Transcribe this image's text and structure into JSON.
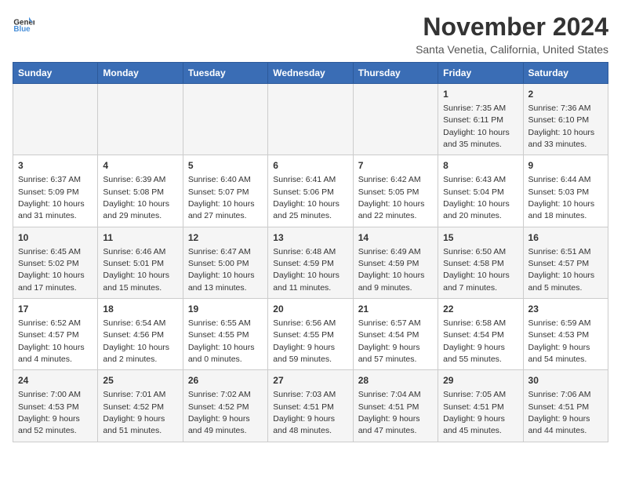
{
  "header": {
    "logo_line1": "General",
    "logo_line2": "Blue",
    "title": "November 2024",
    "location": "Santa Venetia, California, United States"
  },
  "columns": [
    "Sunday",
    "Monday",
    "Tuesday",
    "Wednesday",
    "Thursday",
    "Friday",
    "Saturday"
  ],
  "weeks": [
    [
      {
        "day": "",
        "info": ""
      },
      {
        "day": "",
        "info": ""
      },
      {
        "day": "",
        "info": ""
      },
      {
        "day": "",
        "info": ""
      },
      {
        "day": "",
        "info": ""
      },
      {
        "day": "1",
        "info": "Sunrise: 7:35 AM\nSunset: 6:11 PM\nDaylight: 10 hours\nand 35 minutes."
      },
      {
        "day": "2",
        "info": "Sunrise: 7:36 AM\nSunset: 6:10 PM\nDaylight: 10 hours\nand 33 minutes."
      }
    ],
    [
      {
        "day": "3",
        "info": "Sunrise: 6:37 AM\nSunset: 5:09 PM\nDaylight: 10 hours\nand 31 minutes."
      },
      {
        "day": "4",
        "info": "Sunrise: 6:39 AM\nSunset: 5:08 PM\nDaylight: 10 hours\nand 29 minutes."
      },
      {
        "day": "5",
        "info": "Sunrise: 6:40 AM\nSunset: 5:07 PM\nDaylight: 10 hours\nand 27 minutes."
      },
      {
        "day": "6",
        "info": "Sunrise: 6:41 AM\nSunset: 5:06 PM\nDaylight: 10 hours\nand 25 minutes."
      },
      {
        "day": "7",
        "info": "Sunrise: 6:42 AM\nSunset: 5:05 PM\nDaylight: 10 hours\nand 22 minutes."
      },
      {
        "day": "8",
        "info": "Sunrise: 6:43 AM\nSunset: 5:04 PM\nDaylight: 10 hours\nand 20 minutes."
      },
      {
        "day": "9",
        "info": "Sunrise: 6:44 AM\nSunset: 5:03 PM\nDaylight: 10 hours\nand 18 minutes."
      }
    ],
    [
      {
        "day": "10",
        "info": "Sunrise: 6:45 AM\nSunset: 5:02 PM\nDaylight: 10 hours\nand 17 minutes."
      },
      {
        "day": "11",
        "info": "Sunrise: 6:46 AM\nSunset: 5:01 PM\nDaylight: 10 hours\nand 15 minutes."
      },
      {
        "day": "12",
        "info": "Sunrise: 6:47 AM\nSunset: 5:00 PM\nDaylight: 10 hours\nand 13 minutes."
      },
      {
        "day": "13",
        "info": "Sunrise: 6:48 AM\nSunset: 4:59 PM\nDaylight: 10 hours\nand 11 minutes."
      },
      {
        "day": "14",
        "info": "Sunrise: 6:49 AM\nSunset: 4:59 PM\nDaylight: 10 hours\nand 9 minutes."
      },
      {
        "day": "15",
        "info": "Sunrise: 6:50 AM\nSunset: 4:58 PM\nDaylight: 10 hours\nand 7 minutes."
      },
      {
        "day": "16",
        "info": "Sunrise: 6:51 AM\nSunset: 4:57 PM\nDaylight: 10 hours\nand 5 minutes."
      }
    ],
    [
      {
        "day": "17",
        "info": "Sunrise: 6:52 AM\nSunset: 4:57 PM\nDaylight: 10 hours\nand 4 minutes."
      },
      {
        "day": "18",
        "info": "Sunrise: 6:54 AM\nSunset: 4:56 PM\nDaylight: 10 hours\nand 2 minutes."
      },
      {
        "day": "19",
        "info": "Sunrise: 6:55 AM\nSunset: 4:55 PM\nDaylight: 10 hours\nand 0 minutes."
      },
      {
        "day": "20",
        "info": "Sunrise: 6:56 AM\nSunset: 4:55 PM\nDaylight: 9 hours\nand 59 minutes."
      },
      {
        "day": "21",
        "info": "Sunrise: 6:57 AM\nSunset: 4:54 PM\nDaylight: 9 hours\nand 57 minutes."
      },
      {
        "day": "22",
        "info": "Sunrise: 6:58 AM\nSunset: 4:54 PM\nDaylight: 9 hours\nand 55 minutes."
      },
      {
        "day": "23",
        "info": "Sunrise: 6:59 AM\nSunset: 4:53 PM\nDaylight: 9 hours\nand 54 minutes."
      }
    ],
    [
      {
        "day": "24",
        "info": "Sunrise: 7:00 AM\nSunset: 4:53 PM\nDaylight: 9 hours\nand 52 minutes."
      },
      {
        "day": "25",
        "info": "Sunrise: 7:01 AM\nSunset: 4:52 PM\nDaylight: 9 hours\nand 51 minutes."
      },
      {
        "day": "26",
        "info": "Sunrise: 7:02 AM\nSunset: 4:52 PM\nDaylight: 9 hours\nand 49 minutes."
      },
      {
        "day": "27",
        "info": "Sunrise: 7:03 AM\nSunset: 4:51 PM\nDaylight: 9 hours\nand 48 minutes."
      },
      {
        "day": "28",
        "info": "Sunrise: 7:04 AM\nSunset: 4:51 PM\nDaylight: 9 hours\nand 47 minutes."
      },
      {
        "day": "29",
        "info": "Sunrise: 7:05 AM\nSunset: 4:51 PM\nDaylight: 9 hours\nand 45 minutes."
      },
      {
        "day": "30",
        "info": "Sunrise: 7:06 AM\nSunset: 4:51 PM\nDaylight: 9 hours\nand 44 minutes."
      }
    ]
  ]
}
